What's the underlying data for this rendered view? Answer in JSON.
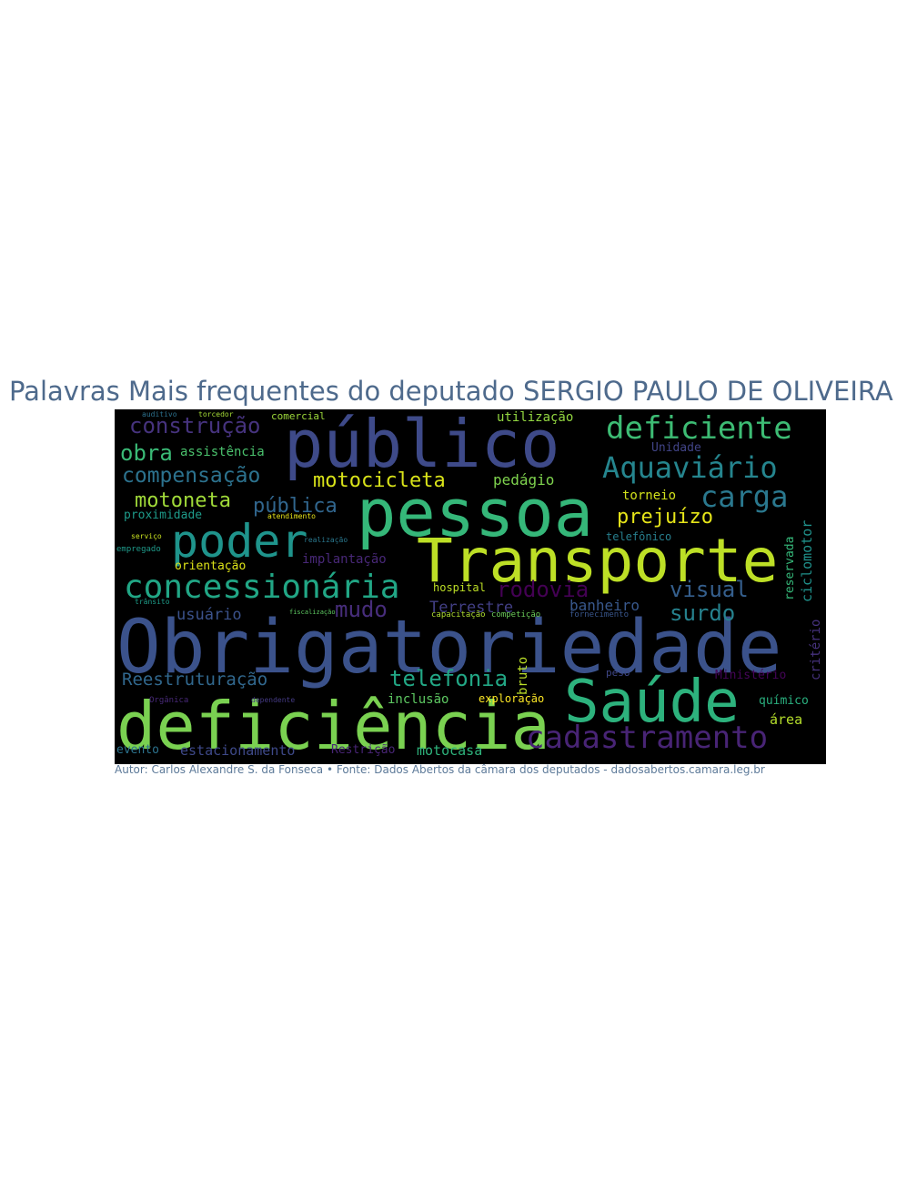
{
  "title": "Palavras Mais frequentes do deputado SERGIO PAULO DE OLIVEIRA",
  "caption": "Autor: Carlos Alexandre S. da Fonseca • Fonte: Dados Abertos da câmara dos deputados - dadosabertos.camara.leg.br",
  "colors": {
    "background": "#000000",
    "title": "#4e6a8c",
    "caption": "#5d7a99"
  },
  "words": [
    {
      "text": "Obrigatoriedade",
      "color": "#3b528b"
    },
    {
      "text": "deficiência",
      "color": "#7ad151"
    },
    {
      "text": "Transporte",
      "color": "#bddf26"
    },
    {
      "text": "pessoa",
      "color": "#35b779"
    },
    {
      "text": "público",
      "color": "#3e4a89"
    },
    {
      "text": "Saúde",
      "color": "#2db27d"
    },
    {
      "text": "poder",
      "color": "#1f948c"
    },
    {
      "text": "cadastramento",
      "color": "#482475"
    },
    {
      "text": "concessionária",
      "color": "#21a685"
    },
    {
      "text": "deficiente",
      "color": "#3dbc74"
    },
    {
      "text": "Aquaviário",
      "color": "#25858e"
    },
    {
      "text": "carga",
      "color": "#2a788e"
    },
    {
      "text": "construção",
      "color": "#46337e"
    },
    {
      "text": "obra",
      "color": "#3aba76"
    },
    {
      "text": "compensação",
      "color": "#2c728e"
    },
    {
      "text": "motocicleta",
      "color": "#d8e219"
    },
    {
      "text": "motoneta",
      "color": "#a0da39"
    },
    {
      "text": "pública",
      "color": "#31668e"
    },
    {
      "text": "prejuízo",
      "color": "#e5e419"
    },
    {
      "text": "rodovia",
      "color": "#440154"
    },
    {
      "text": "visual",
      "color": "#355f8d"
    },
    {
      "text": "surdo",
      "color": "#26828e"
    },
    {
      "text": "telefonia",
      "color": "#22a785"
    },
    {
      "text": "Reestruturação",
      "color": "#31688e"
    },
    {
      "text": "mudo",
      "color": "#472d7b"
    },
    {
      "text": "usuário",
      "color": "#3b528b"
    },
    {
      "text": "Terrestre",
      "color": "#423f85"
    },
    {
      "text": "banheiro",
      "color": "#38588c"
    },
    {
      "text": "pedágio",
      "color": "#7fd34e"
    },
    {
      "text": "torneio",
      "color": "#d2e21b"
    },
    {
      "text": "assistência",
      "color": "#4ac16d"
    },
    {
      "text": "utilização",
      "color": "#93d741"
    },
    {
      "text": "Unidade",
      "color": "#414487"
    },
    {
      "text": "proximidade",
      "color": "#1e9b8a"
    },
    {
      "text": "implantação",
      "color": "#482878"
    },
    {
      "text": "orientação",
      "color": "#dde318"
    },
    {
      "text": "hospital",
      "color": "#bddf26"
    },
    {
      "text": "inclusão",
      "color": "#5ec962"
    },
    {
      "text": "exploração",
      "color": "#fde725"
    },
    {
      "text": "estacionamento",
      "color": "#3e4989"
    },
    {
      "text": "Restrição",
      "color": "#482576"
    },
    {
      "text": "motocasa",
      "color": "#2eb37c"
    },
    {
      "text": "evento",
      "color": "#2c738e"
    },
    {
      "text": "Ministério",
      "color": "#450559"
    },
    {
      "text": "químico",
      "color": "#2ab07f"
    },
    {
      "text": "área",
      "color": "#b5de2b"
    },
    {
      "text": "comercial",
      "color": "#9dd93b"
    },
    {
      "text": "empregado",
      "color": "#1f9a8a"
    },
    {
      "text": "serviço",
      "color": "#c8e020"
    },
    {
      "text": "capacitação",
      "color": "#addc30"
    },
    {
      "text": "competição",
      "color": "#6ccd5a"
    },
    {
      "text": "fornecimento",
      "color": "#39568c"
    },
    {
      "text": "telefônico",
      "color": "#277f8e"
    },
    {
      "text": "atendimento",
      "color": "#e7e419"
    },
    {
      "text": "peso",
      "color": "#3f4788"
    },
    {
      "text": "ciclomotor",
      "color": "#20928c"
    },
    {
      "text": "reservada",
      "color": "#35b779"
    },
    {
      "text": "critério",
      "color": "#46327e"
    },
    {
      "text": "bruto",
      "color": "#bade28"
    },
    {
      "text": "auditivo",
      "color": "#2c728e"
    },
    {
      "text": "torcedor",
      "color": "#a5db36"
    },
    {
      "text": "Orgânica",
      "color": "#482979"
    },
    {
      "text": "dependente",
      "color": "#443a83"
    },
    {
      "text": "trânsito",
      "color": "#1e9d89"
    },
    {
      "text": "realização",
      "color": "#2a788e"
    },
    {
      "text": "fiscalização",
      "color": "#5ec962"
    }
  ]
}
